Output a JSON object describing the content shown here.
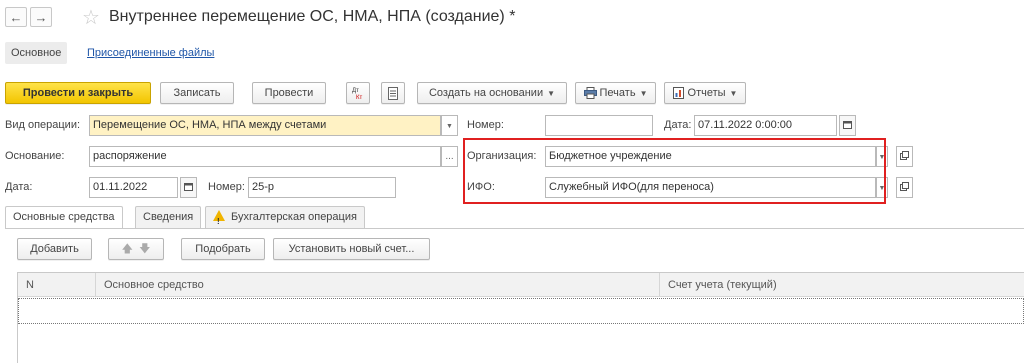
{
  "header": {
    "back_icon": "←",
    "forward_icon": "→",
    "star_icon": "☆",
    "title": "Внутреннее перемещение ОС, НМА, НПА (создание) *"
  },
  "subtabs": {
    "main": "Основное",
    "attached": "Присоединенные файлы"
  },
  "toolbar": {
    "post_close": "Провести и закрыть",
    "save": "Записать",
    "post": "Провести",
    "dt_kt_icon": "Дт/Кт",
    "create_based": "Создать на основании",
    "print": "Печать",
    "reports": "Отчеты"
  },
  "form": {
    "op_type_label": "Вид операции:",
    "op_type_value": "Перемещение ОС, НМА, НПА между счетами",
    "number_label": "Номер:",
    "number_value": "",
    "date_label": "Дата:",
    "date_value": "07.11.2022  0:00:00",
    "basis_label": "Основание:",
    "basis_value": "распоряжение",
    "org_label": "Организация:",
    "org_value": "Бюджетное учреждение",
    "date2_label": "Дата:",
    "date2_value": "01.11.2022",
    "number2_label": "Номер:",
    "number2_value": "25-р",
    "ifo_label": "ИФО:",
    "ifo_value": "Служебный ИФО(для переноса)"
  },
  "tabs": [
    {
      "label": "Основные средства",
      "active": true
    },
    {
      "label": "Сведения",
      "active": false
    },
    {
      "label": "Бухгалтерская операция",
      "active": false,
      "icon": "warning-icon"
    }
  ],
  "table_toolbar": {
    "add": "Добавить",
    "pick": "Подобрать",
    "set_account": "Установить новый счет..."
  },
  "table": {
    "columns": [
      "N",
      "Основное средство",
      "Счет учета (текущий)"
    ]
  },
  "colors": {
    "primary_button": "#f2c500",
    "highlight_box": "#e02020",
    "link": "#1f56a8",
    "required_field": "#fff2c4"
  }
}
